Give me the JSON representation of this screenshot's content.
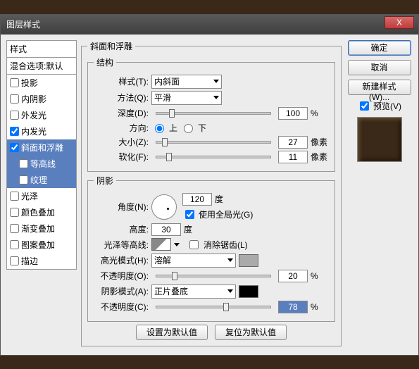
{
  "window": {
    "title": "图层样式",
    "close": "X"
  },
  "left": {
    "head": "样式",
    "sub": "混合选项:默认",
    "items": [
      {
        "label": "投影",
        "checked": false,
        "sel": false,
        "indent": 0
      },
      {
        "label": "内阴影",
        "checked": false,
        "sel": false,
        "indent": 0
      },
      {
        "label": "外发光",
        "checked": false,
        "sel": false,
        "indent": 0
      },
      {
        "label": "内发光",
        "checked": true,
        "sel": false,
        "indent": 0
      },
      {
        "label": "斜面和浮雕",
        "checked": true,
        "sel": true,
        "indent": 0
      },
      {
        "label": "等高线",
        "checked": false,
        "sel": true,
        "indent": 1
      },
      {
        "label": "纹理",
        "checked": false,
        "sel": true,
        "indent": 1
      },
      {
        "label": "光泽",
        "checked": false,
        "sel": false,
        "indent": 0
      },
      {
        "label": "颜色叠加",
        "checked": false,
        "sel": false,
        "indent": 0
      },
      {
        "label": "渐变叠加",
        "checked": false,
        "sel": false,
        "indent": 0
      },
      {
        "label": "图案叠加",
        "checked": false,
        "sel": false,
        "indent": 0
      },
      {
        "label": "描边",
        "checked": false,
        "sel": false,
        "indent": 0
      }
    ]
  },
  "main": {
    "title": "斜面和浮雕",
    "struct": {
      "legend": "结构",
      "style_l": "样式(T):",
      "style_v": "内斜面",
      "tech_l": "方法(Q):",
      "tech_v": "平滑",
      "depth_l": "深度(D):",
      "depth_v": "100",
      "pct": "%",
      "dir_l": "方向:",
      "up": "上",
      "down": "下",
      "size_l": "大小(Z):",
      "size_v": "27",
      "px": "像素",
      "soft_l": "软化(F):",
      "soft_v": "11"
    },
    "shade": {
      "legend": "阴影",
      "angle_l": "角度(N):",
      "angle_v": "120",
      "deg": "度",
      "global_l": "使用全局光(G)",
      "alt_l": "高度:",
      "alt_v": "30",
      "gloss_l": "光泽等高线:",
      "aa_l": "消除锯齿(L)",
      "hlmode_l": "高光模式(H):",
      "hlmode_v": "溶解",
      "hlop_l": "不透明度(O):",
      "hlop_v": "20",
      "shmode_l": "阴影模式(A):",
      "shmode_v": "正片叠底",
      "shop_l": "不透明度(C):",
      "shop_v": "78"
    },
    "btn_def": "设置为默认值",
    "btn_reset": "复位为默认值"
  },
  "right": {
    "ok": "确定",
    "cancel": "取消",
    "newstyle": "新建样式(W)...",
    "preview_l": "预览(V)"
  }
}
